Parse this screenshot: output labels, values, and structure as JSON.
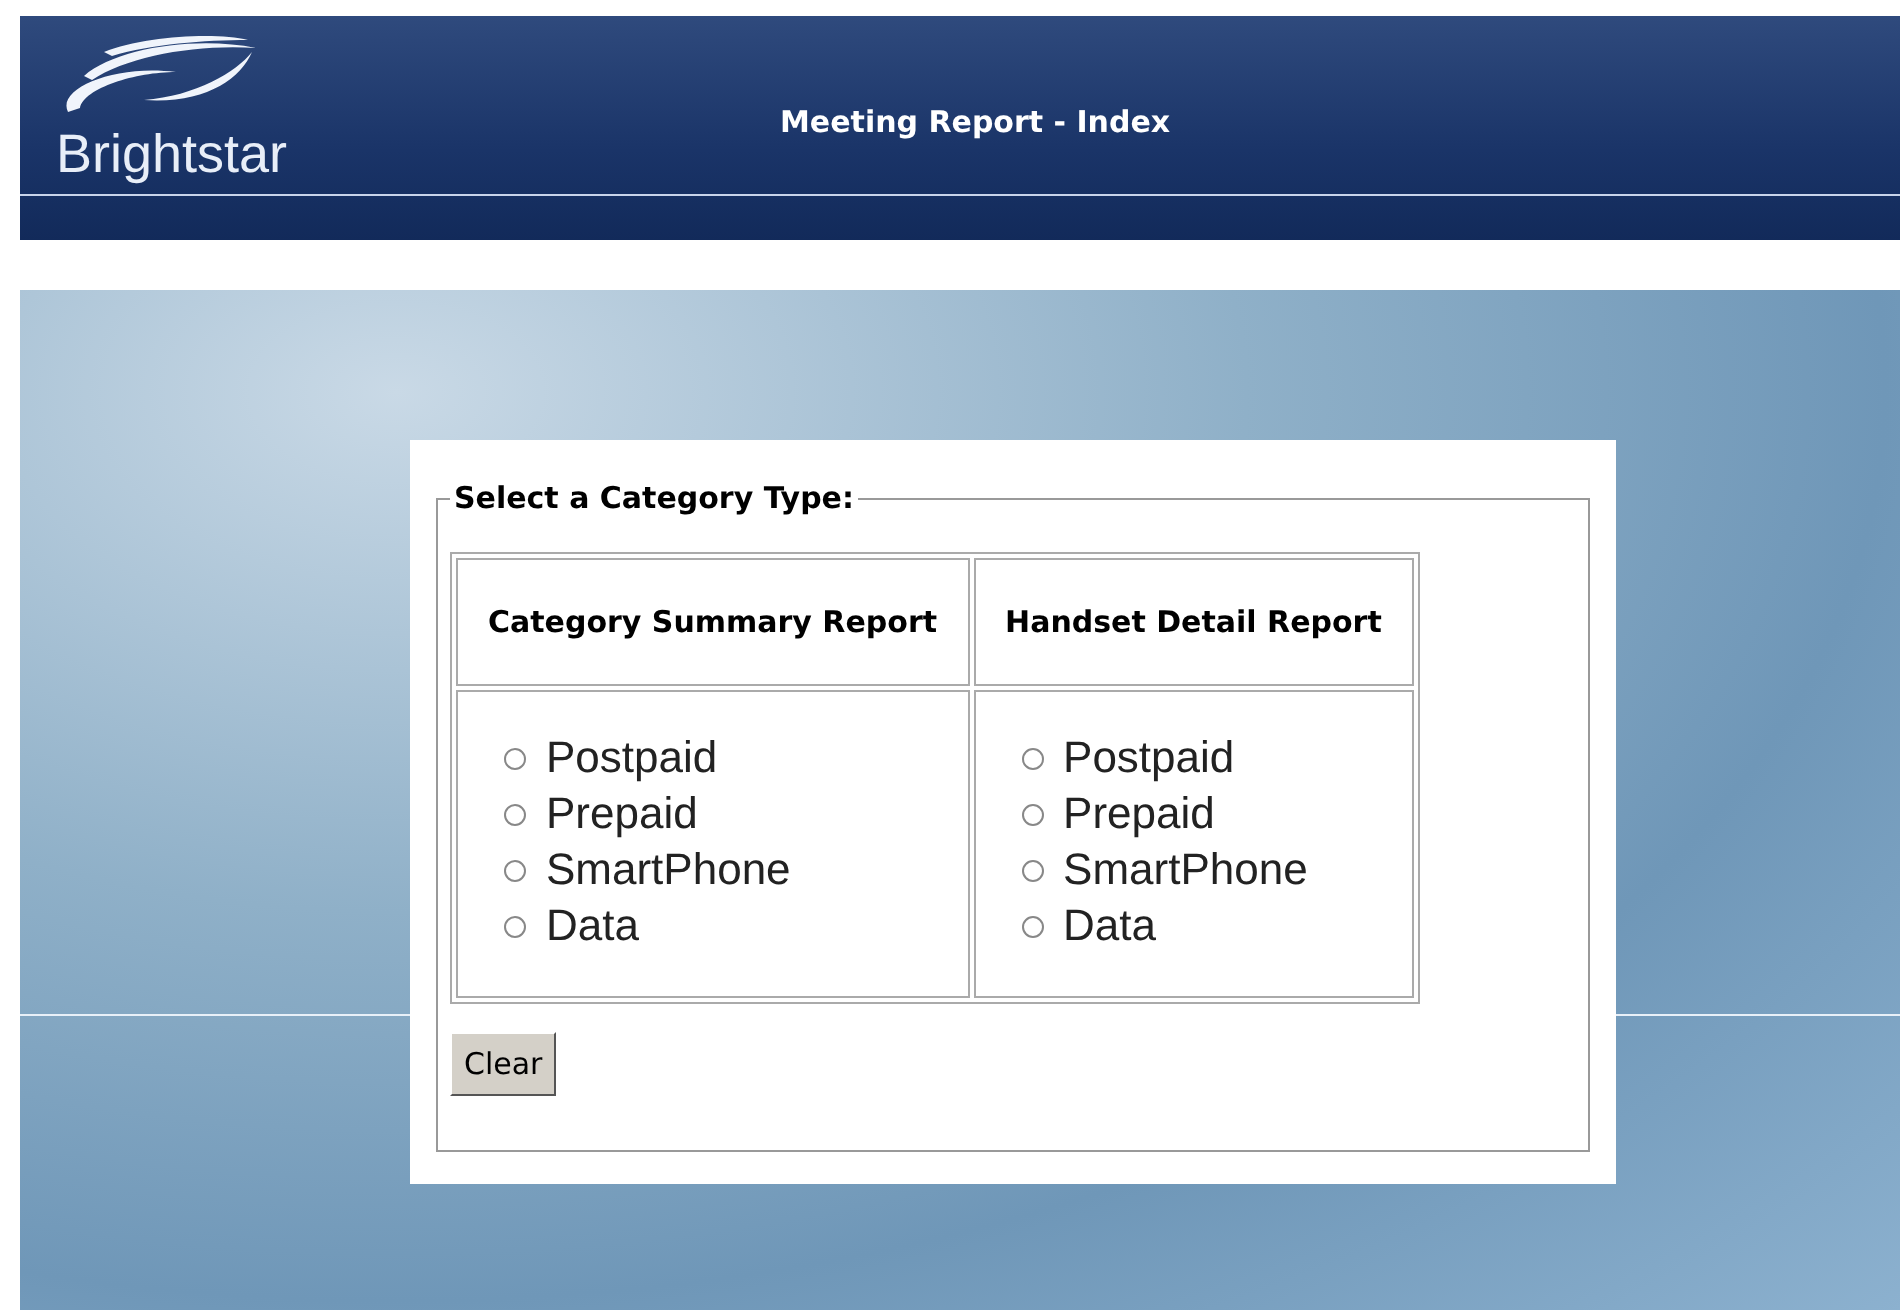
{
  "header": {
    "logo_text": "Brightstar",
    "title": "Meeting Report - Index"
  },
  "form": {
    "legend": "Select a Category Type:",
    "columns": [
      {
        "heading": "Category Summary Report",
        "options": [
          {
            "label": "Postpaid",
            "selected": false
          },
          {
            "label": "Prepaid",
            "selected": false
          },
          {
            "label": "SmartPhone",
            "selected": false
          },
          {
            "label": "Data",
            "selected": false
          }
        ]
      },
      {
        "heading": "Handset Detail Report",
        "options": [
          {
            "label": "Postpaid",
            "selected": false
          },
          {
            "label": "Prepaid",
            "selected": false
          },
          {
            "label": "SmartPhone",
            "selected": false
          },
          {
            "label": "Data",
            "selected": false
          }
        ]
      }
    ],
    "buttons": [
      "Clear"
    ]
  }
}
